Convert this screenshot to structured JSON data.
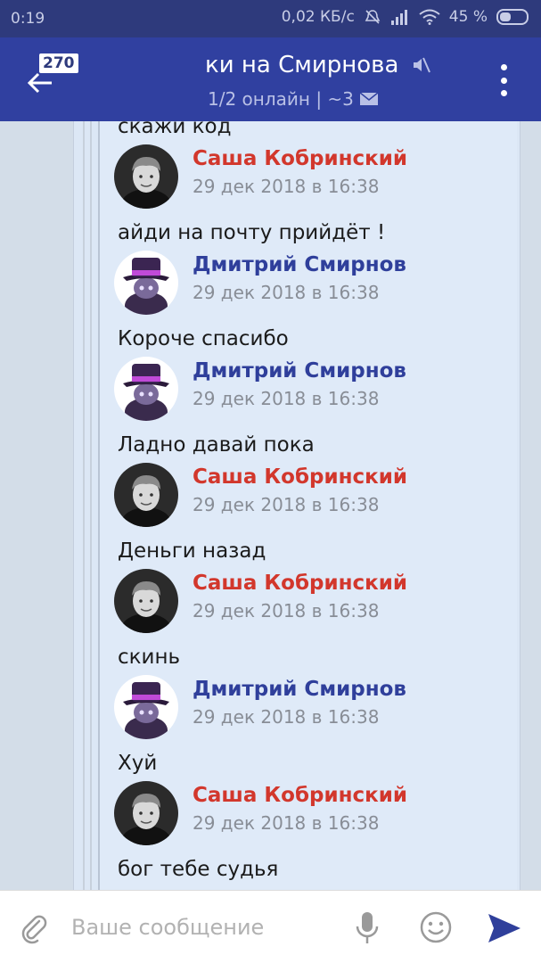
{
  "status_bar": {
    "time": "0:19",
    "network_speed": "0,02 КБ/с",
    "battery": "45 %"
  },
  "header": {
    "unread_count": "270",
    "title": "ки на Смирнова",
    "subtitle": "1/2 онлайн | ~3"
  },
  "messages": [
    {
      "type": "text",
      "text": "скажи код"
    },
    {
      "type": "author",
      "name": "Саша Кобринский",
      "time": "29 дек 2018 в 16:38",
      "color": "#d2372c"
    },
    {
      "type": "text",
      "text": "айди на почту прийдёт !"
    },
    {
      "type": "author",
      "name": "Дмитрий Смирнов",
      "time": "29 дек 2018 в 16:38",
      "color": "#2f3f9b"
    },
    {
      "type": "text",
      "text": "Короче спасибо"
    },
    {
      "type": "author",
      "name": "Дмитрий Смирнов",
      "time": "29 дек 2018 в 16:38",
      "color": "#2f3f9b"
    },
    {
      "type": "text",
      "text": "Ладно давай пока"
    },
    {
      "type": "author",
      "name": "Саша Кобринский",
      "time": "29 дек 2018 в 16:38",
      "color": "#d2372c"
    },
    {
      "type": "text",
      "text": "Деньги назад"
    },
    {
      "type": "author",
      "name": "Саша Кобринский",
      "time": "29 дек 2018 в 16:38",
      "color": "#d2372c"
    },
    {
      "type": "text",
      "text": "скинь"
    },
    {
      "type": "author",
      "name": "Дмитрий Смирнов",
      "time": "29 дек 2018 в 16:38",
      "color": "#2f3f9b"
    },
    {
      "type": "text",
      "text": "Хуй"
    },
    {
      "type": "author",
      "name": "Саша Кобринский",
      "time": "29 дек 2018 в 16:38",
      "color": "#d2372c"
    },
    {
      "type": "text",
      "text": "бог тебе судья"
    }
  ],
  "composer": {
    "placeholder": "Ваше сообщение"
  },
  "colors": {
    "app_bar": "#3040a0",
    "status_bar": "#2e3a7c",
    "author_red": "#d2372c",
    "author_blue": "#2f3f9b",
    "send_accent": "#2f3f9b"
  }
}
